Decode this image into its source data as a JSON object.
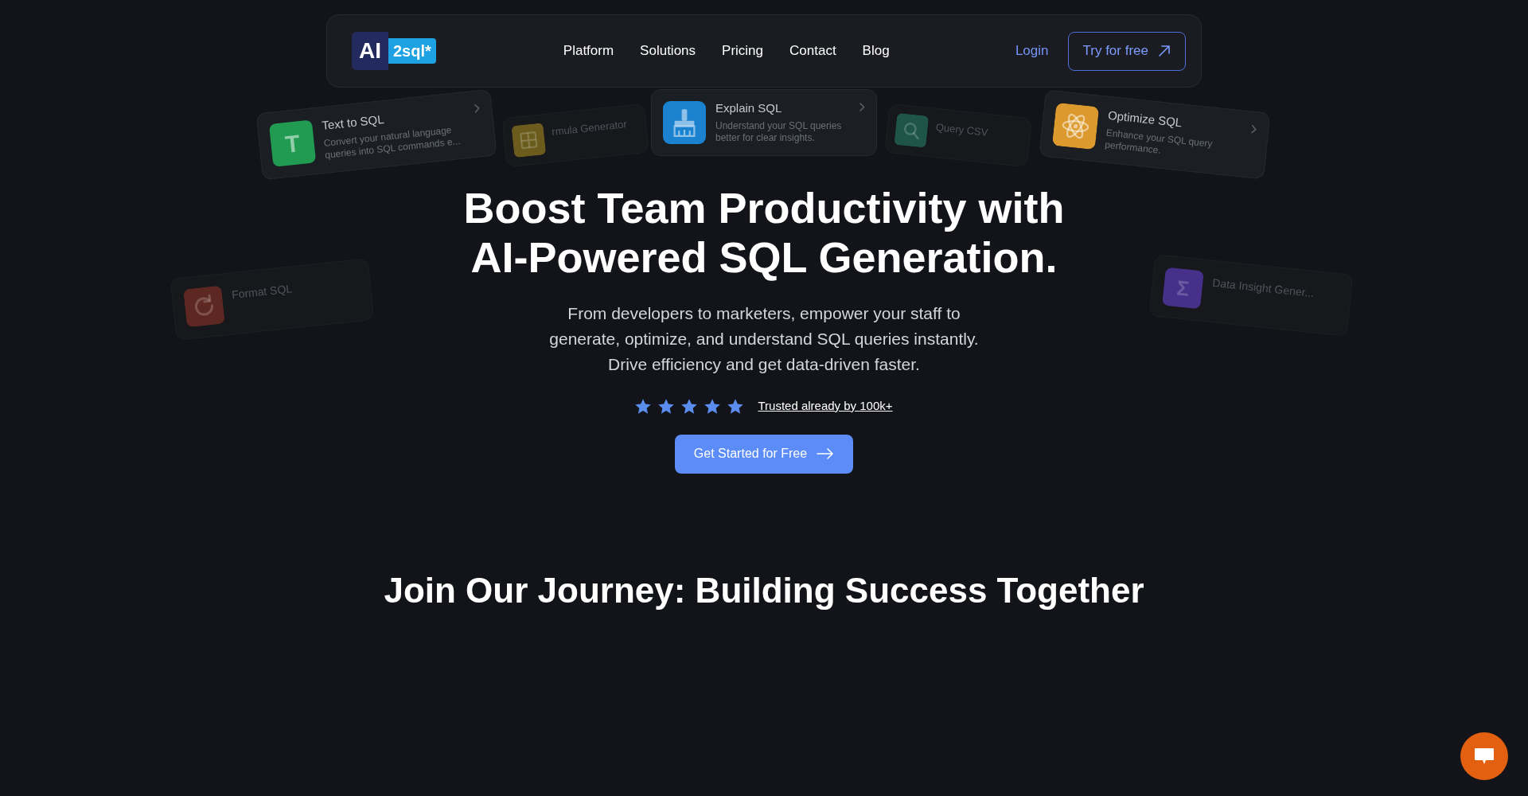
{
  "nav": {
    "logo": {
      "mark": "AI",
      "text": "2sql*"
    },
    "links": [
      "Platform",
      "Solutions",
      "Pricing",
      "Contact",
      "Blog"
    ],
    "login": "Login",
    "cta": "Try for free"
  },
  "feature_cards": [
    {
      "kind": "front",
      "title": "Text to SQL",
      "description": "Convert your natural language queries into SQL commands e...",
      "color": "#219a52",
      "icon_text": "T"
    },
    {
      "kind": "front",
      "title": "Explain SQL",
      "description": "Understand your SQL queries better for clear insights.",
      "color": "#1b82cf"
    },
    {
      "kind": "front",
      "title": "Optimize SQL",
      "description": "Enhance your SQL query performance.",
      "color": "#dc9a2e"
    },
    {
      "kind": "back",
      "title": "Format SQL",
      "color": "#5e2822"
    },
    {
      "kind": "back",
      "title": "rmula Generator",
      "color": "#6b5c1e"
    },
    {
      "kind": "back",
      "title": "Query CSV",
      "color": "#1f5449"
    },
    {
      "kind": "back",
      "title": "Data Insight Gener...",
      "color": "#47308a",
      "icon_text": "Σ"
    }
  ],
  "hero": {
    "heading": "Boost Team Productivity with AI-Powered SQL Generation.",
    "subheading": "From developers to marketers, empower your staff to generate, optimize, and understand SQL queries instantly. Drive efficiency and get data-driven faster.",
    "rating": {
      "stars": 5,
      "text": "Trusted already by 100k+"
    },
    "cta": "Get Started for Free"
  },
  "section_heading": "Join Our Journey: Building Success Together"
}
